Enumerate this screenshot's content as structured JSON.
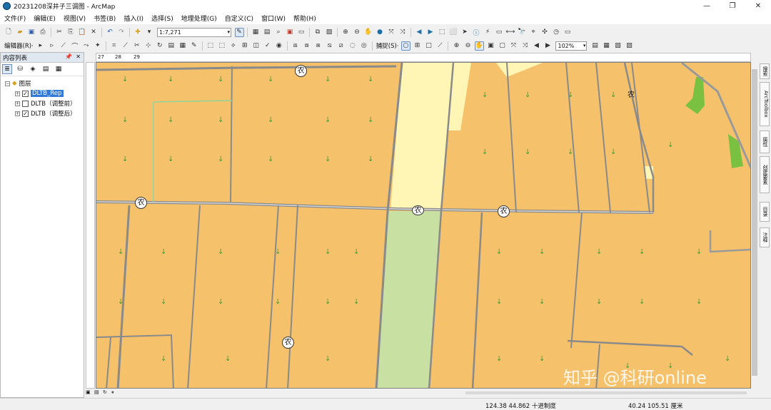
{
  "window": {
    "title": "20231208深井子三调图 - ArcMap",
    "controls": [
      "—",
      "❐",
      "✕"
    ]
  },
  "menu": [
    "文件(F)",
    "编辑(E)",
    "视图(V)",
    "书签(B)",
    "插入(I)",
    "选择(S)",
    "地理处理(G)",
    "自定义(C)",
    "窗口(W)",
    "帮助(H)"
  ],
  "toolbar": {
    "scale_value": "1:7,271",
    "editor_label": "编辑器(R)·",
    "snapping_label": "捕捉(S)·",
    "zoom_value": "102%"
  },
  "toc": {
    "title": "内容列表",
    "root": "图层",
    "layers": [
      {
        "name": "DLTB_Rep",
        "checked": true,
        "selected": true
      },
      {
        "name": "DLTB（调整前）",
        "checked": false,
        "selected": false
      },
      {
        "name": "DLTB（调整后）",
        "checked": true,
        "selected": false
      }
    ]
  },
  "ruler_labels": [
    "27",
    "28",
    "29"
  ],
  "map": {
    "land_label": "农",
    "colors": {
      "farmland": "#f5c26b",
      "road": "#8a8a8a",
      "yellow_strip": "#fff6b5",
      "green_strip": "#c8e0a2",
      "green_patch": "#7ac142",
      "boundary_green": "#8fd49c"
    }
  },
  "right_dock": [
    "搜索",
    "ArcToolbox",
    "属性",
    "创建要素",
    "目录",
    "注释"
  ],
  "status": {
    "coords": "124.38  44.862 十进制度",
    "page": "40.24  105.51 厘米"
  },
  "watermark": "知乎 @科研online"
}
